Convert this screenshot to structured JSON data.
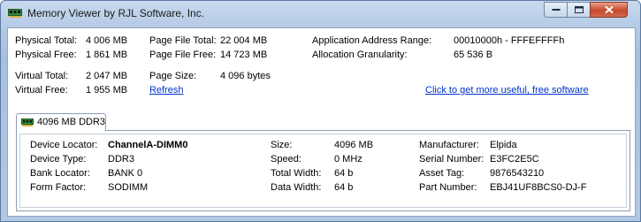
{
  "window": {
    "title": "Memory Viewer by RJL Software, Inc."
  },
  "stats": {
    "physical_total_label": "Physical Total:",
    "physical_total": "4 006 MB",
    "physical_free_label": "Physical Free:",
    "physical_free": "1 861 MB",
    "virtual_total_label": "Virtual Total:",
    "virtual_total": "2 047 MB",
    "virtual_free_label": "Virtual Free:",
    "virtual_free": "1 955 MB",
    "page_file_total_label": "Page File Total:",
    "page_file_total": "22 004 MB",
    "page_file_free_label": "Page File Free:",
    "page_file_free": "14 723 MB",
    "page_size_label": "Page Size:",
    "page_size": "4 096 bytes",
    "refresh_label": "Refresh",
    "app_address_range_label": "Application Address Range:",
    "app_address_range": "00010000h - FFFEFFFFh",
    "alloc_granularity_label": "Allocation Granularity:",
    "alloc_granularity": "65 536 B",
    "promo_link": "Click to get more useful, free software"
  },
  "tab": {
    "label": "4096 MB DDR3"
  },
  "module": {
    "device_locator_label": "Device Locator:",
    "device_locator": "ChannelA-DIMM0",
    "device_type_label": "Device Type:",
    "device_type": "DDR3",
    "bank_locator_label": "Bank Locator:",
    "bank_locator": "BANK 0",
    "form_factor_label": "Form Factor:",
    "form_factor": "SODIMM",
    "size_label": "Size:",
    "size": "4096 MB",
    "speed_label": "Speed:",
    "speed": "0 MHz",
    "total_width_label": "Total Width:",
    "total_width": "64 b",
    "data_width_label": "Data Width:",
    "data_width": "64 b",
    "manufacturer_label": "Manufacturer:",
    "manufacturer": "Elpida",
    "serial_number_label": "Serial Number:",
    "serial_number": "E3FC2E5C",
    "asset_tag_label": "Asset Tag:",
    "asset_tag": "9876543210",
    "part_number_label": "Part Number:",
    "part_number": "EBJ41UF8BCS0-DJ-F"
  },
  "icons": {
    "app": "memory-chip-icon",
    "tab": "memory-chip-icon"
  },
  "colors": {
    "link": "#0033cc",
    "close_button": "#c8492d",
    "frame": "#b5cbe6"
  }
}
